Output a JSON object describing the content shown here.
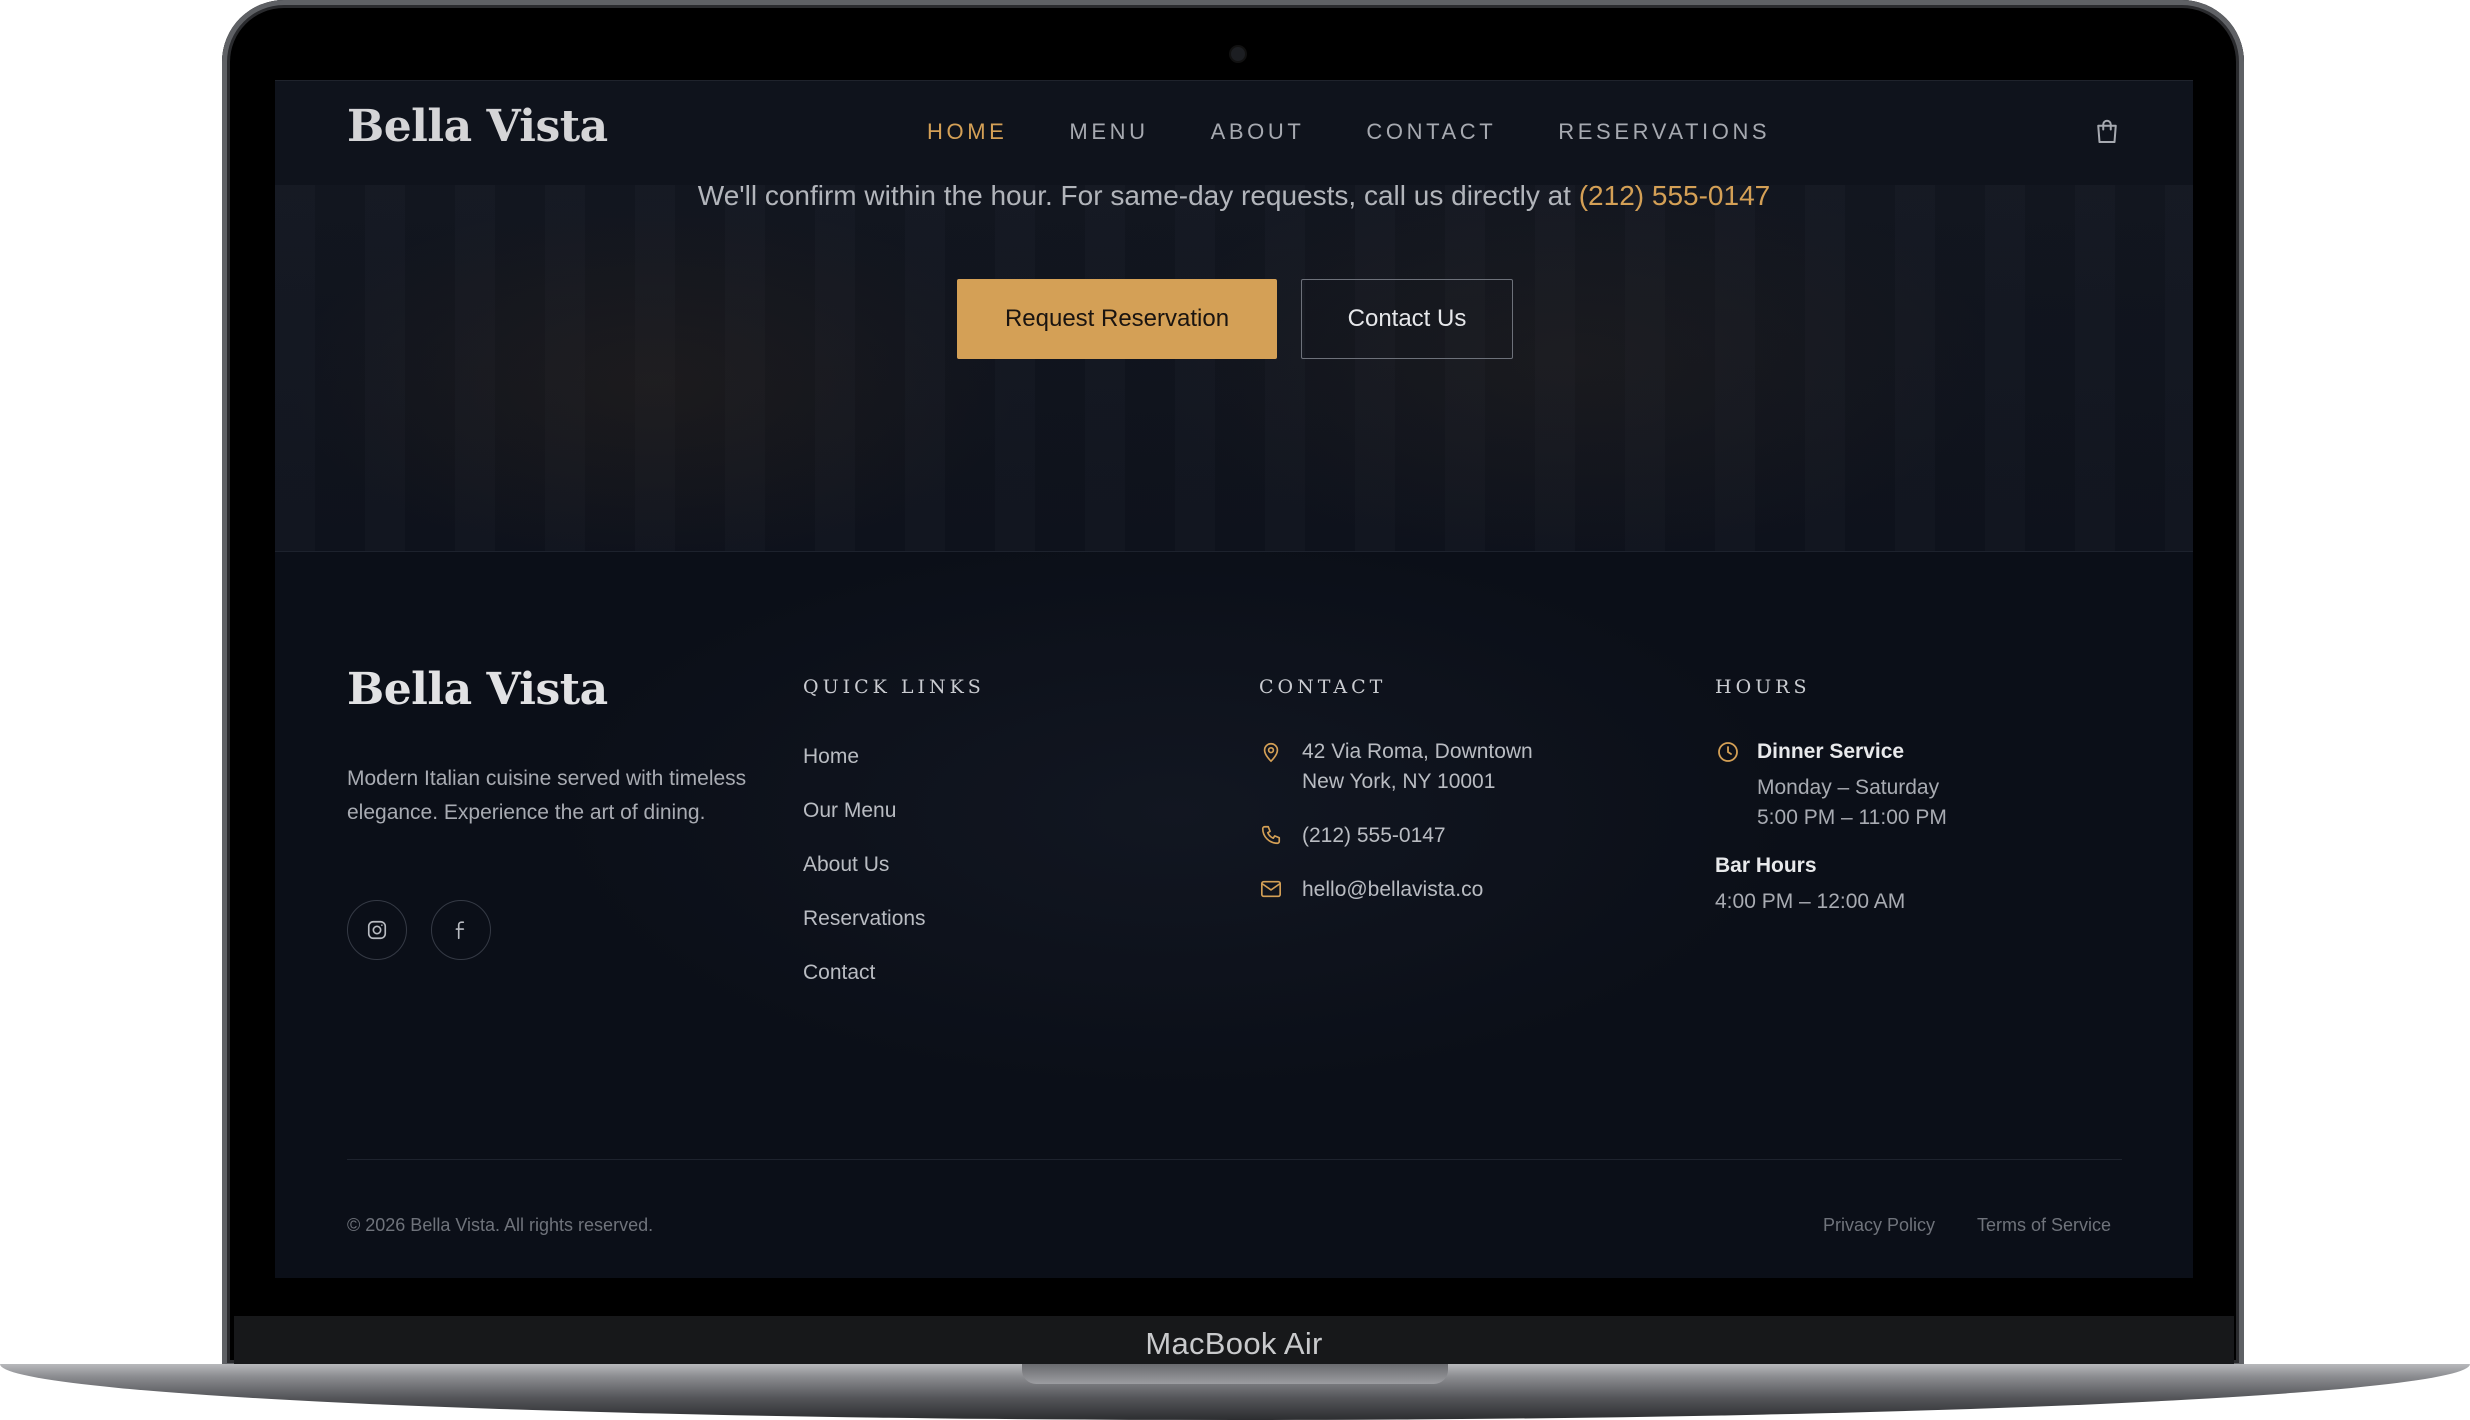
{
  "device": {
    "label": "MacBook Air"
  },
  "colors": {
    "accent": "#d4a056",
    "background": "#0b0f18",
    "text": "#b9bcc2"
  },
  "nav": {
    "brand": "Bella Vista",
    "links": [
      {
        "label": "HOME",
        "active": true
      },
      {
        "label": "MENU",
        "active": false
      },
      {
        "label": "ABOUT",
        "active": false
      },
      {
        "label": "CONTACT",
        "active": false
      },
      {
        "label": "RESERVATIONS",
        "active": false
      }
    ],
    "cart_icon": "shopping-bag-icon"
  },
  "hero": {
    "confirm_text": "We'll confirm within the hour. For same-day requests, call us directly at ",
    "confirm_phone": "(212) 555-0147",
    "primary_button": "Request Reservation",
    "secondary_button": "Contact Us"
  },
  "footer": {
    "brand": "Bella Vista",
    "description": "Modern Italian cuisine served with timeless elegance. Experience the art of dining.",
    "social": [
      "instagram-icon",
      "facebook-icon"
    ],
    "quick_links": {
      "title": "QUICK LINKS",
      "items": [
        "Home",
        "Our Menu",
        "About Us",
        "Reservations",
        "Contact"
      ]
    },
    "contact": {
      "title": "CONTACT",
      "address_line1": "42 Via Roma, Downtown",
      "address_line2": "New York, NY 10001",
      "phone": "(212) 555-0147",
      "email": "hello@bellavista.co"
    },
    "hours": {
      "title": "HOURS",
      "dinner_label": "Dinner Service",
      "dinner_days": "Monday – Saturday",
      "dinner_time": "5:00 PM – 11:00 PM",
      "bar_label": "Bar Hours",
      "bar_time": "4:00 PM – 12:00 AM"
    },
    "copyright": "© 2026 Bella Vista. All rights reserved.",
    "privacy": "Privacy Policy",
    "terms": "Terms of Service"
  }
}
